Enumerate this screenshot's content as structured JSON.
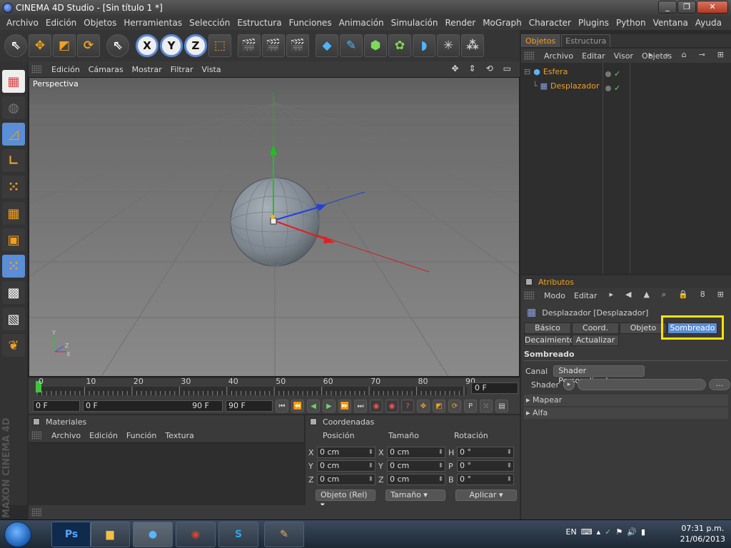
{
  "window": {
    "title": "CINEMA 4D Studio - [Sin título 1 *]",
    "buttons": [
      "_",
      "❐",
      "✕"
    ]
  },
  "menu": [
    "Archivo",
    "Edición",
    "Objetos",
    "Herramientas",
    "Selección",
    "Estructura",
    "Funciones",
    "Animación",
    "Simulación",
    "Render",
    "MoGraph",
    "Character",
    "Plugins",
    "Python",
    "Ventana",
    "Ayuda"
  ],
  "toolbar": {
    "axis_x": "X",
    "axis_y": "Y",
    "axis_z": "Z"
  },
  "viewport": {
    "menu": [
      "Edición",
      "Cámaras",
      "Mostrar",
      "Filtrar",
      "Vista"
    ],
    "label": "Perspectiva",
    "nav_icons": [
      "move-view-icon",
      "dolly-icon",
      "rotate-view-icon",
      "maximize-icon"
    ]
  },
  "timeline": {
    "ticks": [
      "0",
      "10",
      "20",
      "30",
      "40",
      "50",
      "60",
      "70",
      "80",
      "90"
    ],
    "current_frame": "0 F",
    "start": "0 F",
    "range_start": "0 F",
    "range_end": "90 F",
    "end": "90 F"
  },
  "materials": {
    "title": "Materiales",
    "menu": [
      "Archivo",
      "Edición",
      "Función",
      "Textura"
    ]
  },
  "coordinates": {
    "title": "Coordenadas",
    "columns": [
      "Posición",
      "Tamaño",
      "Rotación"
    ],
    "pos_axes": [
      "X",
      "Y",
      "Z"
    ],
    "size_axes": [
      "X",
      "Y",
      "Z"
    ],
    "rot_axes": [
      "H",
      "P",
      "B"
    ],
    "position": [
      "0 cm",
      "0 cm",
      "0 cm"
    ],
    "size": [
      "0 cm",
      "0 cm",
      "0 cm"
    ],
    "rotation": [
      "0 °",
      "0 °",
      "0 °"
    ],
    "mode_dropdown": "Objeto (Rel)",
    "size_dropdown": "Tamaño",
    "apply_button": "Aplicar"
  },
  "objects_panel": {
    "tabs": [
      "Objetos",
      "Estructura"
    ],
    "menu": [
      "Archivo",
      "Editar",
      "Visor",
      "Objetos"
    ],
    "items": [
      {
        "name": "Esfera",
        "icon": "sphere-icon"
      },
      {
        "name": "Desplazador",
        "icon": "displacer-icon"
      }
    ]
  },
  "attributes": {
    "title": "Atributos",
    "menu": [
      "Modo",
      "Editar"
    ],
    "object_title": "Desplazador [Desplazador]",
    "tabs": [
      "Básico",
      "Coord.",
      "Objeto",
      "Sombreado",
      "Decaimiento",
      "Actualizar"
    ],
    "active_tab": "Sombreado",
    "section": "Sombreado",
    "canal_label": "Canal",
    "canal_value": "Shader Personalizado",
    "shader_label": "Shader",
    "shader_more": "...",
    "folds": [
      "Mapear",
      "Alfa"
    ]
  },
  "branding": "MAXON CINEMA 4D",
  "taskbar": {
    "apps": [
      "Ps",
      "explorer-icon",
      "cinema4d-icon",
      "chrome-icon",
      "skype-icon",
      "paint-icon"
    ],
    "lang": "EN",
    "time": "07:31 p.m.",
    "date": "21/06/2013"
  },
  "colors": {
    "accent_orange": "#f0a020",
    "selection_blue": "#5a8ed6",
    "highlight_yellow": "#f5e400",
    "axis_x": "#e03030",
    "axis_y": "#30c030",
    "axis_z": "#3050e0"
  }
}
